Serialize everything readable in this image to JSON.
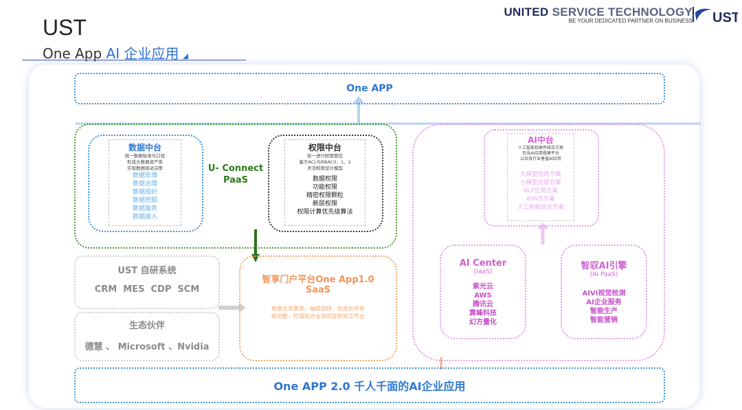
{
  "header": {
    "title": "UST",
    "subtitle_part1": "One App ",
    "subtitle_part2": "AI 企业应用",
    "brand_main_1": "UNITED",
    "brand_main_2": "SERVICE TECHNOLOGY",
    "brand_tagline": "BE YOUR DEDICATED PARTNER ON BUSINESS",
    "logo_text": "UST"
  },
  "diagram": {
    "top_bar": "One APP",
    "bottom_bar": "One APP 2.0 千人千面的AI企业应用",
    "uconnect": {
      "label_line1": "U- Connect",
      "label_line2": "PaaS"
    },
    "data_center": {
      "title": "数据中台",
      "desc": [
        "统一数据标准与口径",
        "形成大数据资产库",
        "实现数据驱动决策"
      ],
      "items": [
        "数据处理",
        "数据治理",
        "数据组织",
        "数据挖掘",
        "数据服务",
        "数据接入"
      ]
    },
    "perm_center": {
      "title": "权限中台",
      "desc": [
        "统一进行权限管控",
        "基于ACL与RBAC0、1、2",
        "灵活权限设计模型"
      ],
      "items": [
        "数据权限",
        "功能权限",
        "精密权限颗粒",
        "断层权限",
        "权限计算优先级算法"
      ]
    },
    "ai_center_top": {
      "title": "AI中台",
      "desc": [
        "人工智能软硬件结合方案",
        "包含AI应用搭建平台",
        "以及各行业垂直AI应用"
      ],
      "items": [
        "大模型应用方案",
        "小模型应用方案",
        "NLP应用方案",
        "AIWIS方案",
        "人工智能综合方案"
      ]
    },
    "ai_iaas": {
      "title": "AI Center",
      "subtitle": "(IaaS)",
      "items": [
        "紫光云",
        "AWS",
        "腾讯云",
        "算峰科技",
        "幻方量化"
      ]
    },
    "ai_paas": {
      "title": "智驭AI引擎",
      "subtitle": "(AI PaaS)",
      "items": [
        "AIVI视觉检测",
        "AI企业服务",
        "智能生产",
        "智能营销"
      ]
    },
    "ust_systems": {
      "title": "UST 自研系统",
      "items": "CRM  MES  CDP  SCM"
    },
    "partners": {
      "title": "生态伙伴",
      "items": "德慧 、 Microsoft 、Nvidia"
    },
    "portal": {
      "title_line1": "智享门户平台One App1.0",
      "title_line2": "SaaS",
      "desc": [
        "根据业务需求，抽取自研、生态伙伴系",
        "统功能，打造贴合业态的定制化工作台"
      ]
    }
  },
  "colors": {
    "blue": "#2e78d0",
    "green": "#3d9a2a",
    "dark_green": "#2c6e1a",
    "pink": "#d15fd3",
    "orange": "#f2a56a",
    "gray": "#9a9a9a"
  }
}
